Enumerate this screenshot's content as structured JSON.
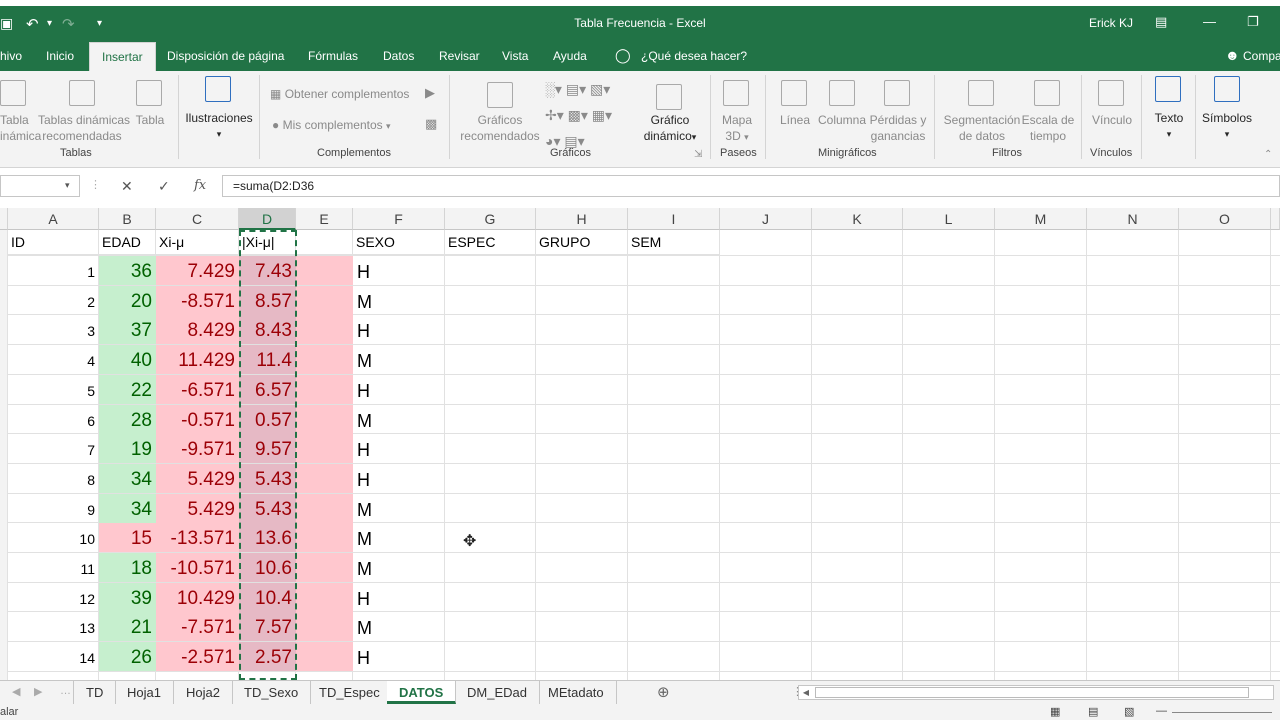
{
  "window": {
    "title": "Tabla Frecuencia  -  Excel",
    "user": "Erick KJ"
  },
  "ribbon_tabs": [
    "hivo",
    "Inicio",
    "Insertar",
    "Disposición de página",
    "Fórmulas",
    "Datos",
    "Revisar",
    "Vista",
    "Ayuda",
    "¿Qué desea hacer?",
    "Compa"
  ],
  "ribbon": {
    "tablas": {
      "group": "Tablas",
      "tabla_dinamica_1": "Tabla",
      "tabla_dinamica_2": "inámica",
      "recomendadas_1": "Tablas dinámicas",
      "recomendadas_2": "recomendadas",
      "tabla": "Tabla"
    },
    "ilustraciones": {
      "label": "Ilustraciones"
    },
    "complementos": {
      "group": "Complementos",
      "obtener": "Obtener complementos",
      "mis": "Mis complementos"
    },
    "graficos": {
      "group": "Gráficos",
      "recomendados_1": "Gráficos",
      "recomendados_2": "recomendados",
      "dinamico_1": "Gráfico",
      "dinamico_2": "dinámico"
    },
    "paseos": {
      "group": "Paseos",
      "mapa_1": "Mapa",
      "mapa_2": "3D"
    },
    "minigraficos": {
      "group": "Minigráficos",
      "linea": "Línea",
      "columna": "Columna",
      "perdidas_1": "Pérdidas y",
      "perdidas_2": "ganancias"
    },
    "filtros": {
      "group": "Filtros",
      "segmentacion_1": "Segmentación",
      "segmentacion_2": "de datos",
      "escala_1": "Escala de",
      "escala_2": "tiempo"
    },
    "vinculos": {
      "group": "Vínculos",
      "vinculo": "Vínculo"
    },
    "texto": {
      "label": "Texto"
    },
    "simbolos": {
      "label": "Símbolos"
    }
  },
  "formula_bar": {
    "formula": "=suma(D2:D36"
  },
  "columns": [
    "A",
    "B",
    "C",
    "D",
    "E",
    "F",
    "G",
    "H",
    "I",
    "J",
    "K",
    "L",
    "M",
    "N",
    "O"
  ],
  "sheet": {
    "headers": {
      "A": "ID",
      "B": "EDAD",
      "C": "Xi-μ",
      "D": "|Xi-μ|",
      "F": "SEXO",
      "G": "ESPEC",
      "H": "GRUPO",
      "I": "SEM"
    },
    "rows": [
      {
        "id": "1",
        "edad": "36",
        "dev": "7.429",
        "abs": "7.43",
        "sexo": "H"
      },
      {
        "id": "2",
        "edad": "20",
        "dev": "-8.571",
        "abs": "8.57",
        "sexo": "M"
      },
      {
        "id": "3",
        "edad": "37",
        "dev": "8.429",
        "abs": "8.43",
        "sexo": "H"
      },
      {
        "id": "4",
        "edad": "40",
        "dev": "11.429",
        "abs": "11.4",
        "sexo": "M"
      },
      {
        "id": "5",
        "edad": "22",
        "dev": "-6.571",
        "abs": "6.57",
        "sexo": "H"
      },
      {
        "id": "6",
        "edad": "28",
        "dev": "-0.571",
        "abs": "0.57",
        "sexo": "M"
      },
      {
        "id": "7",
        "edad": "19",
        "dev": "-9.571",
        "abs": "9.57",
        "sexo": "H"
      },
      {
        "id": "8",
        "edad": "34",
        "dev": "5.429",
        "abs": "5.43",
        "sexo": "H"
      },
      {
        "id": "9",
        "edad": "34",
        "dev": "5.429",
        "abs": "5.43",
        "sexo": "M"
      },
      {
        "id": "10",
        "edad": "15",
        "dev": "-13.571",
        "abs": "13.6",
        "sexo": "M"
      },
      {
        "id": "11",
        "edad": "18",
        "dev": "-10.571",
        "abs": "10.6",
        "sexo": "M"
      },
      {
        "id": "12",
        "edad": "39",
        "dev": "10.429",
        "abs": "10.4",
        "sexo": "H"
      },
      {
        "id": "13",
        "edad": "21",
        "dev": "-7.571",
        "abs": "7.57",
        "sexo": "M"
      },
      {
        "id": "14",
        "edad": "26",
        "dev": "-2.571",
        "abs": "2.57",
        "sexo": "H"
      }
    ]
  },
  "sheet_tabs": [
    "TD",
    "Hoja1",
    "Hoja2",
    "TD_Sexo",
    "TD_Espec",
    "DATOS",
    "DM_EDad",
    "MEtadato"
  ],
  "active_sheet": "DATOS",
  "status": {
    "mode": "alar"
  },
  "colors": {
    "excel_green": "#217346",
    "green_fill": "#c6efce",
    "green_text": "#006100",
    "red_fill": "#ffc7ce",
    "red_text": "#9c0006",
    "selected_fill": "#e6b9c5"
  }
}
